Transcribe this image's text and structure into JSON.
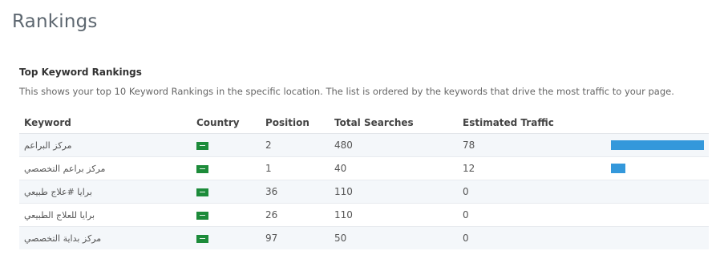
{
  "page": {
    "title": "Rankings"
  },
  "section": {
    "title": "Top Keyword Rankings",
    "description": "This shows your top 10 Keyword Rankings in the specific location. The list is ordered by the keywords that drive the most traffic to your page."
  },
  "table": {
    "headers": {
      "keyword": "Keyword",
      "country": "Country",
      "position": "Position",
      "total_searches": "Total Searches",
      "estimated_traffic": "Estimated Traffic"
    },
    "rows": [
      {
        "keyword": "مركز البراعم",
        "country_icon": "saudi-arabia-flag-icon",
        "position": "2",
        "total_searches": "480",
        "estimated_traffic": "78",
        "traffic_fraction": 1.0
      },
      {
        "keyword": "مركز براعم التخصصي",
        "country_icon": "saudi-arabia-flag-icon",
        "position": "1",
        "total_searches": "40",
        "estimated_traffic": "12",
        "traffic_fraction": 0.154
      },
      {
        "keyword": "برايا #علاج طبيعي",
        "country_icon": "saudi-arabia-flag-icon",
        "position": "36",
        "total_searches": "110",
        "estimated_traffic": "0",
        "traffic_fraction": 0
      },
      {
        "keyword": "برايا للعلاج الطبيعي",
        "country_icon": "saudi-arabia-flag-icon",
        "position": "26",
        "total_searches": "110",
        "estimated_traffic": "0",
        "traffic_fraction": 0
      },
      {
        "keyword": "مركز بداية التخصصي",
        "country_icon": "saudi-arabia-flag-icon",
        "position": "97",
        "total_searches": "50",
        "estimated_traffic": "0",
        "traffic_fraction": 0
      }
    ]
  },
  "colors": {
    "bar": "#3498db",
    "flag": "#1c8b3a",
    "row_alt": "#f4f7fa"
  }
}
